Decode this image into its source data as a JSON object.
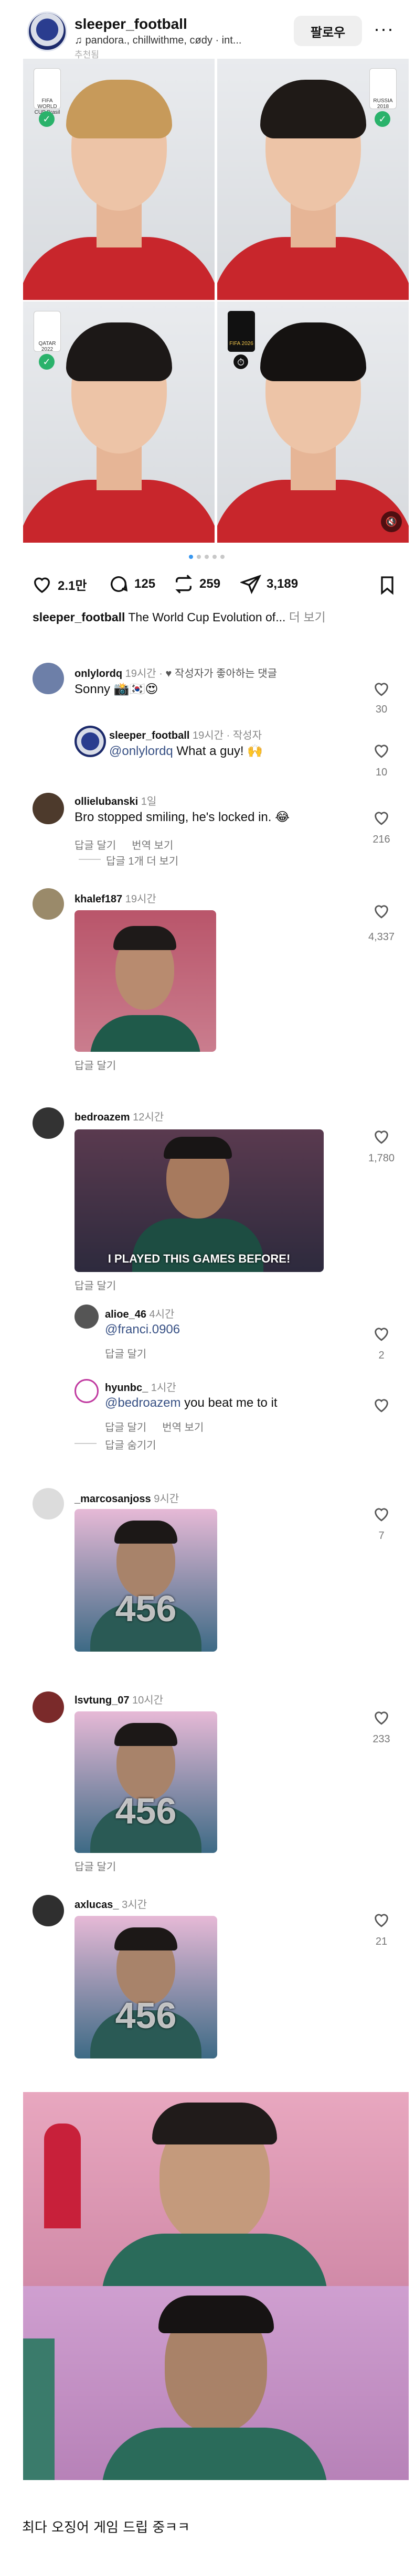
{
  "post": {
    "username": "sleeper_football",
    "music": "♫ pandora., chillwithme, cødy · int...",
    "sub_caption": "추천됨",
    "follow_label": "팔로우",
    "more_label": "···",
    "likes": "2.1만",
    "comments": "125",
    "reposts": "259",
    "shares": "3,189",
    "caption_user": "sleeper_football",
    "caption_text": " The World Cup Evolution of... ",
    "caption_more": "더 보기",
    "tiles": [
      {
        "logo_text": "FIFA WORLD CUP Brasil",
        "hair": "#c79a5a"
      },
      {
        "logo_text": "RUSSIA 2018",
        "hair": "#1f1a17"
      },
      {
        "logo_text": "QATAR 2022",
        "hair": "#1c1817"
      },
      {
        "logo_text": "FIFA 2026",
        "hair": "#151211"
      }
    ]
  },
  "comments": [
    {
      "user": "onlylordq",
      "time": " 19시간 · ",
      "liked_by_author": "♥ 작성자가 좋아하는 댓글",
      "text": "Sonny 📸🇰🇷😍",
      "likes": "30",
      "avatar_color": "#6d7fa8"
    },
    {
      "user": "sleeper_football",
      "time": " 19시간 · 작성자",
      "mention": "@onlylordq",
      "text": " What a guy! 🙌",
      "likes": "10",
      "avatar_color": "#2a3d8f"
    },
    {
      "user": "ollielubanski",
      "time": " 1일",
      "text": "Bro stopped smiling, he's locked in. 😂",
      "reply": "답글 달기",
      "translate": "번역 보기",
      "view_more": "답글 1개 더 보기",
      "likes": "216",
      "avatar_color": "#4d3a2c"
    },
    {
      "user": "khalef187",
      "time": " 19시간",
      "reply": "답글 달기",
      "likes": "4,337",
      "avatar_color": "#9a8a6a"
    },
    {
      "user": "bedroazem",
      "time": " 12시간",
      "reply": "답글 달기",
      "gif_text": "I PLAYED THIS GAMES BEFORE!",
      "likes": "1,780",
      "avatar_color": "#333333"
    },
    {
      "user": "alioe_46",
      "time": " 4시간",
      "mention": "@franci.0906",
      "reply": "답글 달기",
      "likes": "2",
      "avatar_color": "#555555"
    },
    {
      "user": "hyunbc_",
      "time": " 1시간",
      "mention": "@bedroazem",
      "text": " you beat me to it",
      "reply": "답글 달기",
      "translate": "번역 보기",
      "hide": "답글 숨기기",
      "avatar_color": "#ffffff"
    },
    {
      "user": "_marcosanjoss",
      "time": " 9시간",
      "likes": "7",
      "avatar_color": "#dcdcdc",
      "gif_num": "456"
    },
    {
      "user": "lsvtung_07",
      "time": " 10시간",
      "reply": "답글 달기",
      "likes": "233",
      "avatar_color": "#7a2a2a",
      "gif_num": "456"
    },
    {
      "user": "axlucas_",
      "time": " 3시간",
      "likes": "21",
      "avatar_color": "#2f2f2f",
      "gif_num": "456"
    }
  ],
  "bottom_caption": "최다 오징어 게임 드립 중ㅋㅋ",
  "colors": {
    "accent": "#3897f0",
    "like_red": "#ed4956",
    "jersey": "#c8262c"
  }
}
